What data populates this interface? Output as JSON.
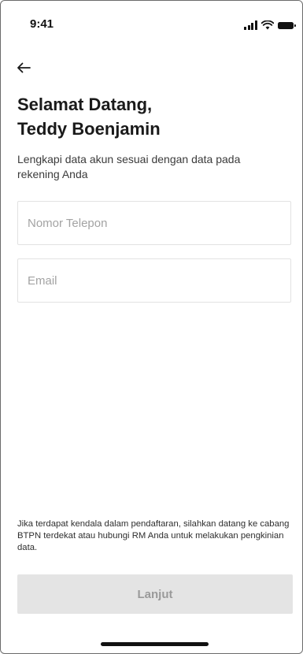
{
  "status_bar": {
    "time": "9:41",
    "icons": [
      "cellular-signal-icon",
      "wifi-icon",
      "battery-icon"
    ]
  },
  "nav": {
    "back_icon": "arrow-left-icon"
  },
  "header": {
    "title_line1": "Selamat Datang,",
    "title_line2": "Teddy Boenjamin",
    "subtitle": "Lengkapi data akun sesuai dengan data pada rekening Anda"
  },
  "form": {
    "phone": {
      "value": "",
      "placeholder": "Nomor Telepon"
    },
    "email": {
      "value": "",
      "placeholder": "Email"
    }
  },
  "footer": {
    "help_text": "Jika terdapat kendala dalam pendaftaran, silahkan datang ke cabang BTPN terdekat atau hubungi RM Anda untuk melakukan pengkinian data.",
    "submit_label": "Lanjut",
    "submit_enabled": false
  },
  "colors": {
    "text_primary": "#1a1a1a",
    "placeholder": "#a3a3a3",
    "field_border": "#e2e2e2",
    "button_disabled_bg": "#e4e4e4",
    "button_disabled_text": "#9a9a9a"
  }
}
